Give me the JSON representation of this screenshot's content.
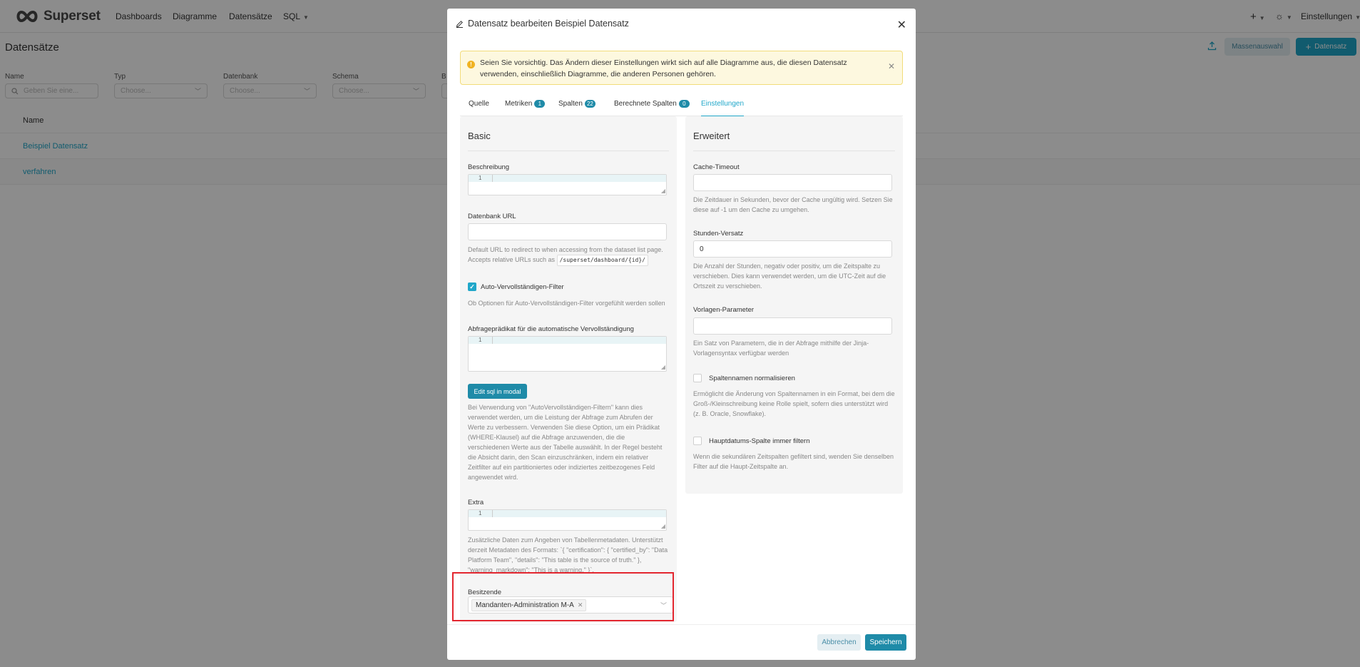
{
  "app": {
    "logo_text": "Superset",
    "nav": [
      "Dashboards",
      "Diagramme",
      "Datensätze",
      "SQL"
    ],
    "settings_label": "Einstellungen"
  },
  "page": {
    "title": "Datensätze",
    "bulk_select_label": "Massenauswahl",
    "add_dataset_label": "Datensatz",
    "filters": [
      {
        "label": "Name",
        "placeholder": "Geben Sie eine..."
      },
      {
        "label": "Typ",
        "placeholder": "Choose..."
      },
      {
        "label": "Datenbank",
        "placeholder": "Choose..."
      },
      {
        "label": "Schema",
        "placeholder": "Choose..."
      },
      {
        "label": "B"
      }
    ],
    "list_header": "Name",
    "rows": [
      "Beispiel Datensatz",
      "verfahren"
    ]
  },
  "modal": {
    "title": "Datensatz bearbeiten Beispiel Datensatz",
    "alert": "Seien Sie vorsichtig. Das Ändern dieser Einstellungen wirkt sich auf alle Diagramme aus, die diesen Datensatz verwenden, einschließlich Diagramme, die anderen Personen gehören.",
    "tabs": [
      {
        "label": "Quelle"
      },
      {
        "label": "Metriken",
        "count": "1"
      },
      {
        "label": "Spalten",
        "count": "22"
      },
      {
        "label": "Berechnete Spalten",
        "count": "0"
      },
      {
        "label": "Einstellungen"
      }
    ],
    "basic": {
      "title": "Basic",
      "description_label": "Beschreibung",
      "line_number": "1",
      "db_url_label": "Datenbank URL",
      "db_url_help": "Default URL to redirect to when accessing from the dataset list page. Accepts relative URLs such as",
      "db_url_example": "/superset/dashboard/{id}/",
      "autocomplete_label": "Auto-Vervollständigen-Filter",
      "autocomplete_checked": true,
      "autocomplete_help": "Ob Optionen für Auto-Vervollständigen-Filter vorgefühlt werden sollen",
      "predicate_label": "Abfrageprädikat für die automatische Vervollständigung",
      "edit_sql_label": "Edit sql in modal",
      "predicate_help": "Bei Verwendung von \"AutoVervollständigen-Filtern\" kann dies verwendet werden, um die Leistung der Abfrage zum Abrufen der Werte zu verbessern. Verwenden Sie diese Option, um ein Prädikat (WHERE-Klausel) auf die Abfrage anzuwenden, die die verschiedenen Werte aus der Tabelle auswählt. In der Regel besteht die Absicht darin, den Scan einzuschränken, indem ein relativer Zeitfilter auf ein partitioniertes oder indiziertes zeitbezogenes Feld angewendet wird.",
      "extra_label": "Extra",
      "extra_help": "Zusätzliche Daten zum Angeben von Tabellenmetadaten. Unterstützt derzeit Metadaten des Formats: `{ \"certification\": { \"certified_by\": \"Data Platform Team\", \"details\": \"This table is the source of truth.\" }, \"warning_markdown\": \"This is a warning.\" }`.",
      "owners_label": "Besitzende",
      "owner_tag": "Mandanten-Administration M-A"
    },
    "advanced": {
      "title": "Erweitert",
      "cache_label": "Cache-Timeout",
      "cache_value": "",
      "cache_help": "Die Zeitdauer in Sekunden, bevor der Cache ungültig wird. Setzen Sie diese auf -1 um den Cache zu umgehen.",
      "offset_label": "Stunden-Versatz",
      "offset_value": "0",
      "offset_help": "Die Anzahl der Stunden, negativ oder positiv, um die Zeitspalte zu verschieben. Dies kann verwendet werden, um die UTC-Zeit auf die Ortszeit zu verschieben.",
      "template_label": "Vorlagen-Parameter",
      "template_value": "",
      "template_help": "Ein Satz von Parametern, die in der Abfrage mithilfe der Jinja-Vorlagensyntax verfügbar werden",
      "normalize_label": "Spaltennamen normalisieren",
      "normalize_checked": false,
      "normalize_help": "Ermöglicht die Änderung von Spaltennamen in ein Format, bei dem die Groß-/Kleinschreibung keine Rolle spielt, sofern dies unterstützt wird (z. B. Oracle, Snowflake).",
      "always_filter_label": "Hauptdatums-Spalte immer filtern",
      "always_filter_checked": false,
      "always_filter_help": "Wenn die sekundären Zeitspalten gefiltert sind, wenden Sie denselben Filter auf die Haupt-Zeitspalte an."
    },
    "cancel_label": "Abbrechen",
    "save_label": "Speichern"
  },
  "colors": {
    "primary": "#20a7c9",
    "primary_dark": "#1f8ba8",
    "highlight": "#e3262f"
  }
}
